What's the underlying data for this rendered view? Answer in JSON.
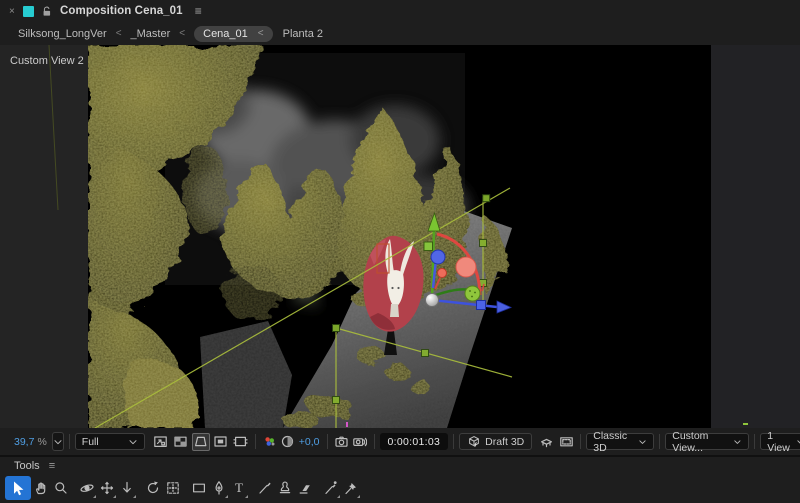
{
  "panel_tab": {
    "close_label": "×",
    "menu_label": "≡",
    "title": "Composition Cena_01"
  },
  "breadcrumbs": {
    "separator": "<",
    "items": [
      "Silksong_LongVer",
      "_Master",
      "Cena_01",
      "Planta 2"
    ],
    "active_item": "Cena_01"
  },
  "viewport": {
    "view_label": "Custom View 2"
  },
  "viewer_bar": {
    "zoom_value": "39,7",
    "zoom_unit": "%",
    "magnification": "Full",
    "exposure": "+0,0",
    "timecode": "0:00:01:03",
    "draft_3d_label": "Draft 3D",
    "renderer": "Classic 3D",
    "view_name": "Custom View...",
    "view_layout": "1 View",
    "icons": [
      "grid-and-guide-options",
      "transparency-grid",
      "mask-and-shape-visibility",
      "region-of-interest",
      "pixel-aspect-correction",
      "show-channel",
      "resolution",
      "snapshot",
      "show-snapshot",
      "ground-plane",
      "extended-viewer"
    ],
    "active_icon": "mask-and-shape-visibility"
  },
  "tools_panel": {
    "title": "Tools",
    "menu_label": "≡",
    "type_tool_glyph": "T",
    "active_tool": "selection",
    "tools": [
      "selection",
      "hand",
      "zoom",
      "orbit-camera",
      "pan-camera",
      "dolly-camera",
      "rotation",
      "pan-behind-anchor",
      "rectangle",
      "pen",
      "type",
      "brush",
      "clone-stamp",
      "eraser",
      "roto-brush",
      "puppet-pin"
    ]
  },
  "colors": {
    "accent_blue": "#4f9ee3",
    "tab_swatch_cyan": "#27ccd1",
    "selection_highlight": "#2474d4",
    "gizmo_green": "#7ac431",
    "gizmo_red": "#e04840",
    "gizmo_blue": "#4a5fe0",
    "wireframe_olive": "#a9bd3c",
    "flower_red": "#b2414b"
  }
}
